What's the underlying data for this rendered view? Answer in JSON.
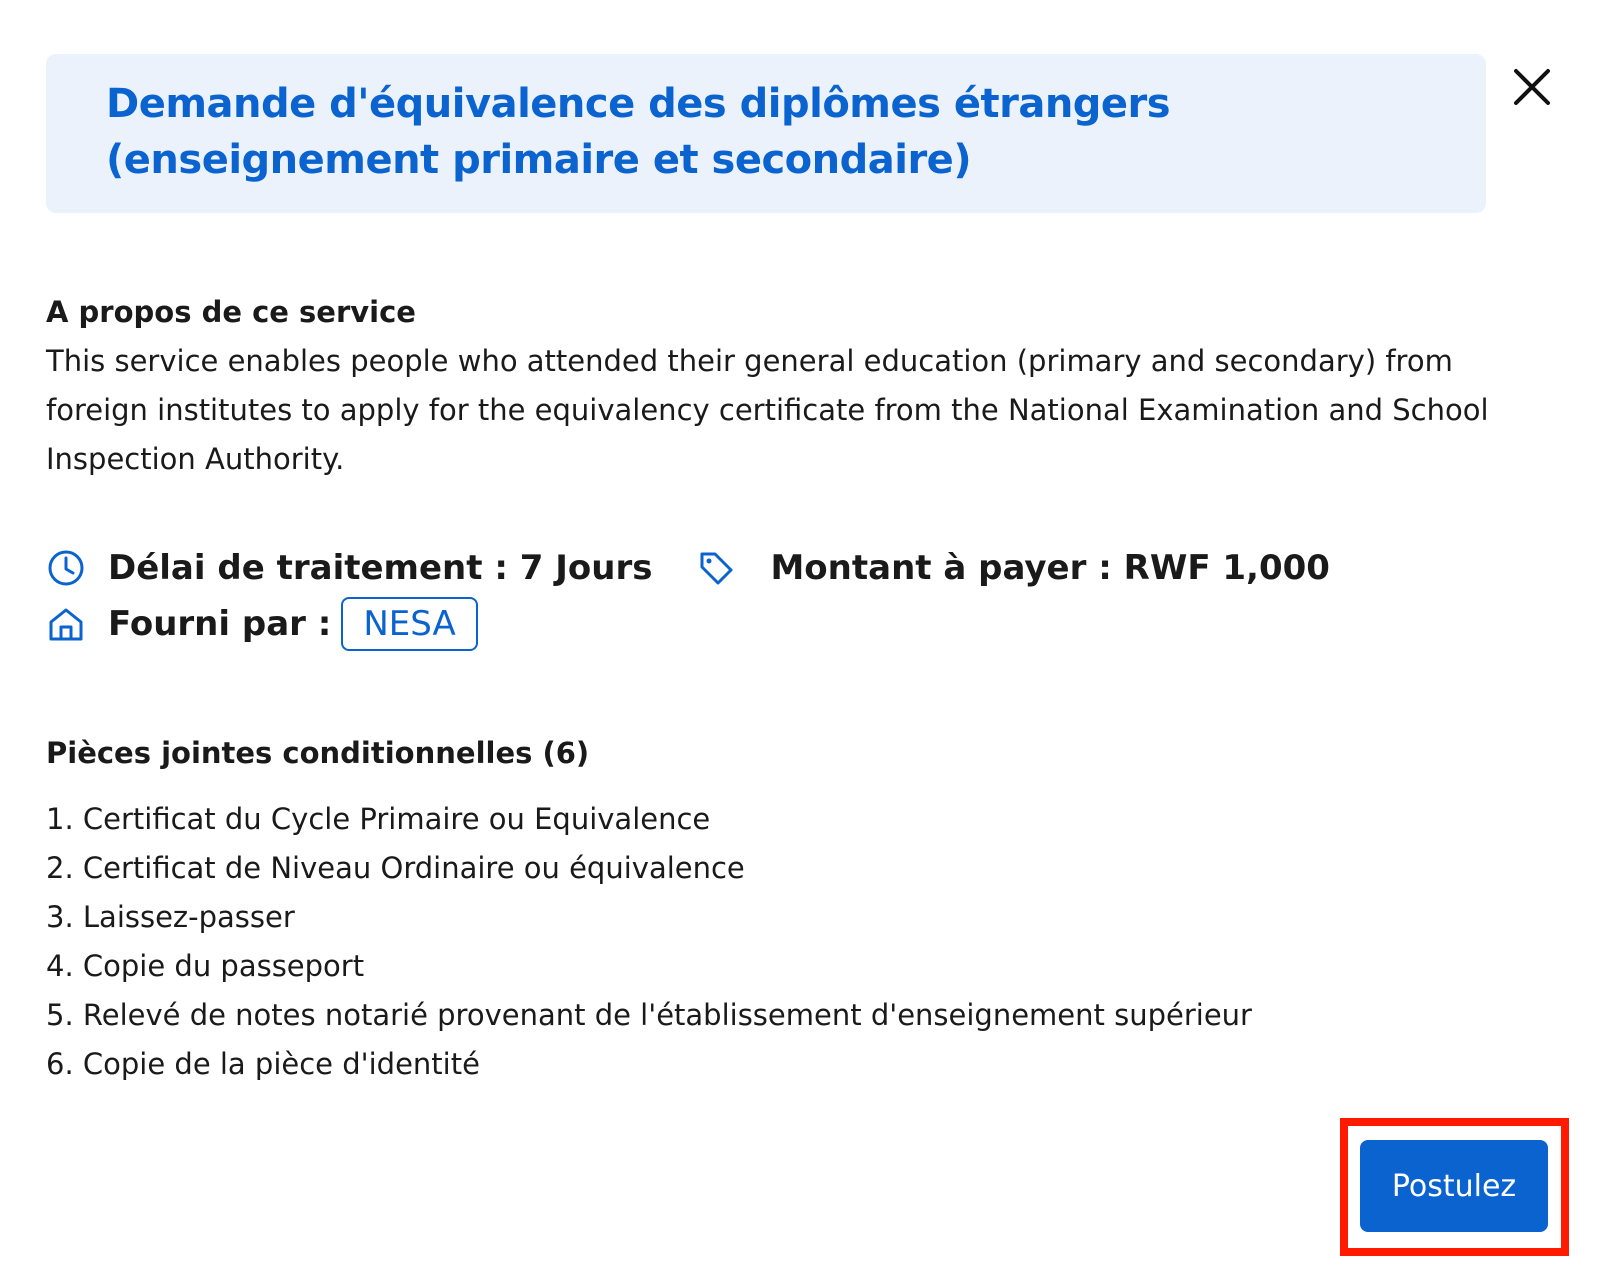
{
  "header": {
    "title_line1": "Demande d'équivalence des diplômes étrangers",
    "title_line2": "(enseignement primaire et secondaire)"
  },
  "close_icon": "close-icon",
  "about": {
    "title": "A propos de ce service",
    "description": "This service enables people who attended their general education (primary and secondary) from foreign institutes to apply for the equivalency certificate from the National Examination and School Inspection Authority."
  },
  "meta": {
    "processing_time": "Délai de traitement : 7 Jours",
    "amount": "Montant à payer : RWF 1,000",
    "provided_by_label": "Fourni par :",
    "provider": "NESA",
    "icons": [
      "clock-icon",
      "tag-icon",
      "home-icon"
    ]
  },
  "attachments": {
    "title": "Pièces jointes conditionnelles (6)",
    "items": [
      "1. Certificat du Cycle Primaire ou Equivalence",
      "2. Certificat de Niveau Ordinaire ou équivalence",
      "3. Laissez-passer",
      "4. Copie du passeport",
      "5. Relevé de notes notarié provenant de l'établissement d'enseignement supérieur",
      "6. Copie de la pièce d'identité"
    ]
  },
  "actions": {
    "apply_label": "Postulez"
  },
  "colors": {
    "accent": "#0a63cf",
    "header_bg": "#ebf2fc",
    "highlight": "#ff1a00"
  }
}
